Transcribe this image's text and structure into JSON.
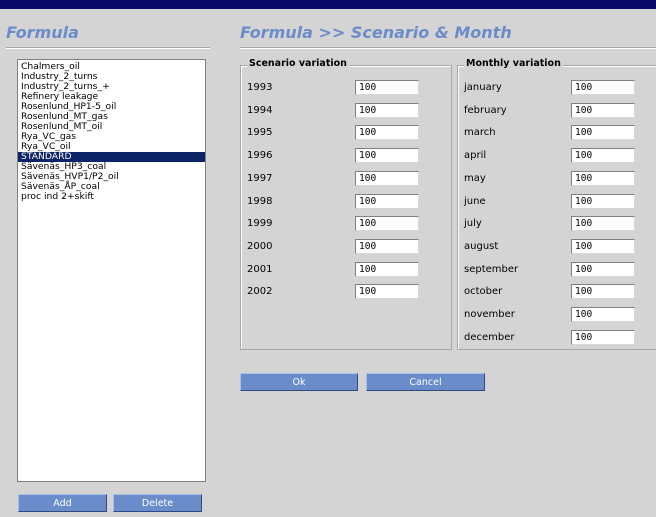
{
  "left": {
    "title": "Formula",
    "items": [
      "Chalmers_oil",
      "Industry_2_turns",
      "Industry_2_turns_+",
      "Refinery leakage",
      "Rosenlund_HP1-5_oil",
      "Rosenlund_MT_gas",
      "Rosenlund_MT_oil",
      "Rya_VC_gas",
      "Rya_VC_oil",
      "STANDARD",
      "Sävenäs_HP3_coal",
      "Sävenäs_HVP1/P2_oil",
      "Sävenäs_ÅP_coal",
      "proc ind 2+skift"
    ],
    "selected_index": 9,
    "add_label": "Add",
    "delete_label": "Delete"
  },
  "right": {
    "title": "Formula >> Scenario & Month",
    "scenario": {
      "legend": "Scenario variation",
      "rows": [
        {
          "label": "1993",
          "value": "100"
        },
        {
          "label": "1994",
          "value": "100"
        },
        {
          "label": "1995",
          "value": "100"
        },
        {
          "label": "1996",
          "value": "100"
        },
        {
          "label": "1997",
          "value": "100"
        },
        {
          "label": "1998",
          "value": "100"
        },
        {
          "label": "1999",
          "value": "100"
        },
        {
          "label": "2000",
          "value": "100"
        },
        {
          "label": "2001",
          "value": "100"
        },
        {
          "label": "2002",
          "value": "100"
        }
      ]
    },
    "monthly": {
      "legend": "Monthly variation",
      "rows": [
        {
          "label": "january",
          "value": "100"
        },
        {
          "label": "february",
          "value": "100"
        },
        {
          "label": "march",
          "value": "100"
        },
        {
          "label": "april",
          "value": "100"
        },
        {
          "label": "may",
          "value": "100"
        },
        {
          "label": "june",
          "value": "100"
        },
        {
          "label": "july",
          "value": "100"
        },
        {
          "label": "august",
          "value": "100"
        },
        {
          "label": "september",
          "value": "100"
        },
        {
          "label": "october",
          "value": "100"
        },
        {
          "label": "november",
          "value": "100"
        },
        {
          "label": "december",
          "value": "100"
        }
      ]
    },
    "ok_label": "Ok",
    "cancel_label": "Cancel"
  },
  "colors": {
    "title": "#6b8cc8",
    "button": "#6a8ccb",
    "selection": "#0a2467",
    "topbar": "#080868",
    "background": "#d4d4d4"
  }
}
